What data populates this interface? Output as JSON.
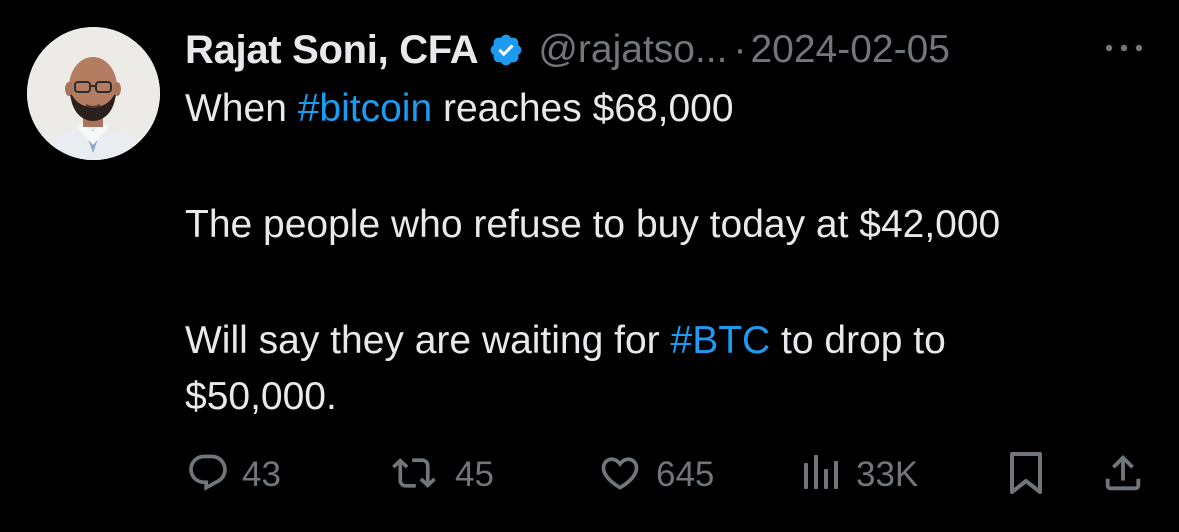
{
  "author": {
    "display_name": "Rajat Soni, CFA",
    "handle": "@rajatso...",
    "separator": "·",
    "date": "2024-02-05",
    "verified": true
  },
  "tweet": {
    "line1_pre": "When ",
    "line1_tag": "#bitcoin",
    "line1_post": " reaches $68,000",
    "line2": "The people who refuse to buy today at $42,000",
    "line3_pre": "Will say they are waiting for ",
    "line3_tag": "#BTC",
    "line3_post": " to drop to",
    "line4": "$50,000."
  },
  "actions": {
    "replies": "43",
    "reposts": "45",
    "likes": "645",
    "views": "33K"
  },
  "icons": {
    "more": "more-icon",
    "reply": "reply-icon",
    "repost": "repost-icon",
    "like": "heart-icon",
    "views": "views-icon",
    "bookmark": "bookmark-icon",
    "share": "share-icon",
    "verified": "verified-badge-icon"
  },
  "colors": {
    "background": "#000000",
    "text": "#e7e9ea",
    "muted": "#71767b",
    "link": "#1d9bf0",
    "verified": "#1d9bf0"
  }
}
